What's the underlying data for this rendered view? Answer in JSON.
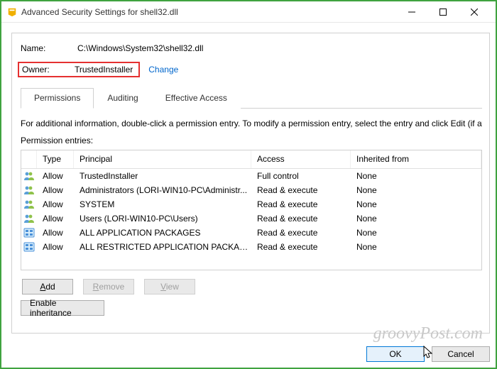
{
  "window": {
    "title": "Advanced Security Settings for shell32.dll"
  },
  "name": {
    "label": "Name:",
    "value": "C:\\Windows\\System32\\shell32.dll"
  },
  "owner": {
    "label": "Owner:",
    "value": "TrustedInstaller",
    "change": "Change"
  },
  "tabs": [
    "Permissions",
    "Auditing",
    "Effective Access"
  ],
  "active_tab": 0,
  "info_text": "For additional information, double-click a permission entry. To modify a permission entry, select the entry and click Edit (if availa",
  "entries_label": "Permission entries:",
  "columns": {
    "type": "Type",
    "principal": "Principal",
    "access": "Access",
    "inherited": "Inherited from"
  },
  "rows": [
    {
      "icon": "users",
      "type": "Allow",
      "principal": "TrustedInstaller",
      "access": "Full control",
      "inherited": "None"
    },
    {
      "icon": "users",
      "type": "Allow",
      "principal": "Administrators (LORI-WIN10-PC\\Administr...",
      "access": "Read & execute",
      "inherited": "None"
    },
    {
      "icon": "users",
      "type": "Allow",
      "principal": "SYSTEM",
      "access": "Read & execute",
      "inherited": "None"
    },
    {
      "icon": "users",
      "type": "Allow",
      "principal": "Users (LORI-WIN10-PC\\Users)",
      "access": "Read & execute",
      "inherited": "None"
    },
    {
      "icon": "pkg",
      "type": "Allow",
      "principal": "ALL APPLICATION PACKAGES",
      "access": "Read & execute",
      "inherited": "None"
    },
    {
      "icon": "pkg",
      "type": "Allow",
      "principal": "ALL RESTRICTED APPLICATION PACKAGES",
      "access": "Read & execute",
      "inherited": "None"
    }
  ],
  "buttons": {
    "add": "Add",
    "remove": "Remove",
    "view": "View",
    "enable_inh": "Enable inheritance",
    "ok": "OK",
    "cancel": "Cancel"
  },
  "watermark": "groovyPost.com"
}
